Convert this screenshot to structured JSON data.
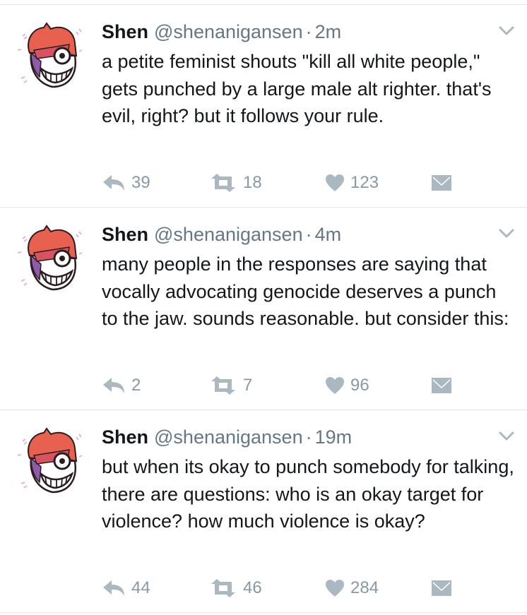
{
  "tweets": [
    {
      "author": {
        "name": "Shen",
        "handle": "@shenanigansen"
      },
      "separator": "·",
      "time": "2m",
      "text": "a petite feminist shouts \"kill all white people,\" gets punched by a large male alt righter. that's evil, right? but it follows your rule.",
      "replies": "39",
      "retweets": "18",
      "likes": "123"
    },
    {
      "author": {
        "name": "Shen",
        "handle": "@shenanigansen"
      },
      "separator": "·",
      "time": "4m",
      "text": "many people in the responses are saying that vocally advocating genocide deserves a punch to the jaw. sounds reasonable. but consider this:",
      "replies": "2",
      "retweets": "7",
      "likes": "96"
    },
    {
      "author": {
        "name": "Shen",
        "handle": "@shenanigansen"
      },
      "separator": "·",
      "time": "19m",
      "text": "but when its okay to punch somebody for talking, there are questions: who is an okay target for violence? how much violence is okay?",
      "replies": "44",
      "retweets": "46",
      "likes": "284"
    }
  ],
  "icons": {
    "avatar": "avatar-icon",
    "more": "chevron-down-icon",
    "reply": "reply-icon",
    "retweet": "retweet-icon",
    "like": "heart-icon",
    "dm": "envelope-icon"
  },
  "colors": {
    "text": "#14171a",
    "muted": "#657786",
    "icon": "#aab8c2",
    "divider": "#e1e8ed",
    "avatar_hair": "#e8604e",
    "avatar_shade": "#8e5ba8"
  }
}
